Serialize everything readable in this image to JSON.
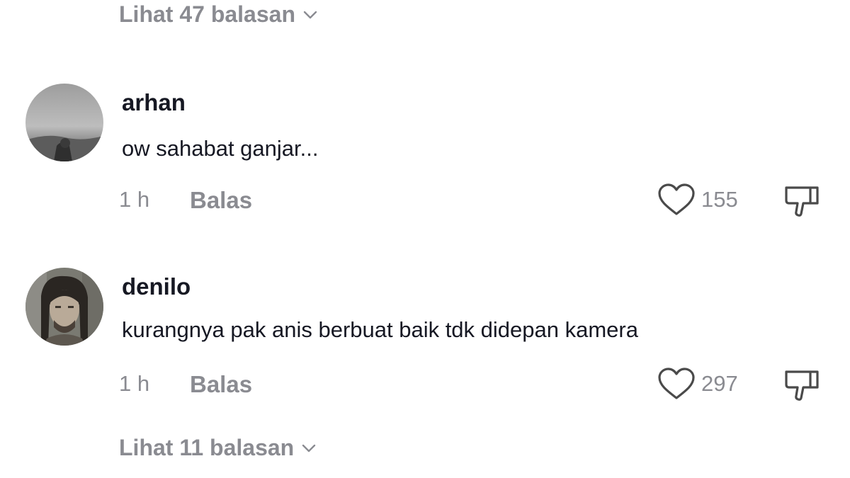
{
  "top_view_replies": {
    "label": "Lihat 47 balasan",
    "icon": "chevron-down-icon"
  },
  "comments": [
    {
      "username": "arhan",
      "text": "ow sahabat ganjar...",
      "time": "1 h",
      "reply_label": "Balas",
      "likes": "155"
    },
    {
      "username": "denilo",
      "text": "kurangnya pak anis berbuat baik tdk didepan kamera",
      "time": "1 h",
      "reply_label": "Balas",
      "likes": "297"
    }
  ],
  "bottom_view_replies": {
    "label": "Lihat 11 balasan",
    "icon": "chevron-down-icon"
  },
  "colors": {
    "text": "#161823",
    "muted": "#8a8b91",
    "background": "#ffffff"
  }
}
